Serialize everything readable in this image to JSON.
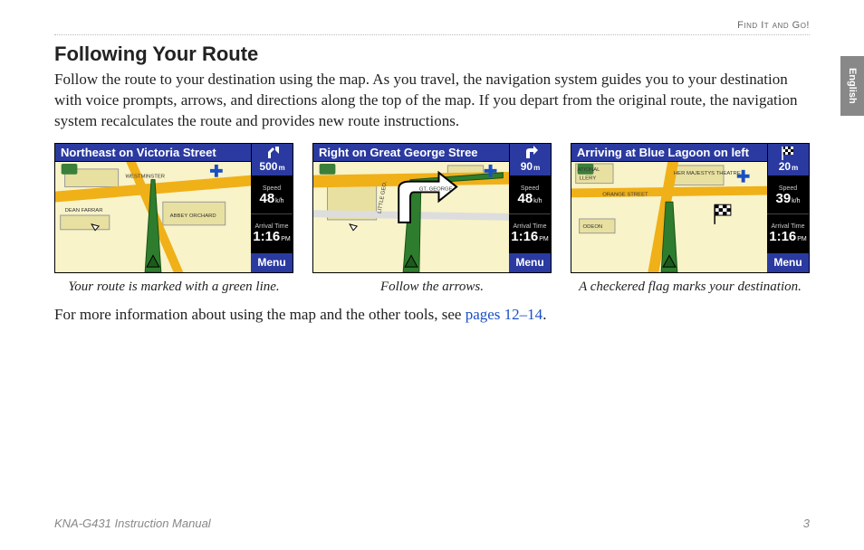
{
  "header": {
    "section": "Find It and Go!"
  },
  "sideTab": "English",
  "title": "Following Your Route",
  "intro": "Follow the route to your destination using the map. As you travel, the navigation system guides you to your destination with voice prompts, arrows, and directions along the top of the map. If you depart from the original route, the navigation system recalculates the route and provides new route instructions.",
  "figures": [
    {
      "titlebar": "Northeast on Victoria Street",
      "turnDistance": "500",
      "turnUnit": "m",
      "speedLabel": "Speed",
      "speed": "48",
      "speedUnit": "k/h",
      "arrivalLabel": "Arrival Time",
      "arrival": "1:16",
      "arrivalUnit": "PM",
      "menu": "Menu",
      "caption": "Your route is marked with a green line.",
      "mapLabels": [
        "WESTMINSTER",
        "DEAN FARRAR",
        "ABBEY ORCHARD"
      ],
      "destFlag": false
    },
    {
      "titlebar": "Right on Great George Stree",
      "turnDistance": "90",
      "turnUnit": "m",
      "speedLabel": "Speed",
      "speed": "48",
      "speedUnit": "k/h",
      "arrivalLabel": "Arrival Time",
      "arrival": "1:16",
      "arrivalUnit": "PM",
      "menu": "Menu",
      "caption": "Follow the arrows.",
      "mapLabels": [
        "GT. GEORGE",
        "LITTLE GEO."
      ],
      "destFlag": false
    },
    {
      "titlebar": "Arriving at Blue Lagoon on left",
      "turnDistance": "20",
      "turnUnit": "m",
      "speedLabel": "Speed",
      "speed": "39",
      "speedUnit": "k/h",
      "arrivalLabel": "Arrival Time",
      "arrival": "1:16",
      "arrivalUnit": "PM",
      "menu": "Menu",
      "caption": "A checkered flag marks your destination.",
      "mapLabels": [
        "ATIONAL",
        "LLERY",
        "HER MAJESTYS THEATRE",
        "ORANGE STREET",
        "ODEON"
      ],
      "destFlag": true
    }
  ],
  "moreInfo": {
    "prefix": "For more information about using the map and the other tools, see ",
    "link": "pages 12–14",
    "suffix": "."
  },
  "footer": {
    "left": "KNA-G431 Instruction Manual",
    "right": "3"
  },
  "colors": {
    "navBlue": "#2a3aa0",
    "mapBg": "#f8f3c8",
    "routeGreen": "#2e7d2e",
    "roadYellow": "#f0b018"
  }
}
